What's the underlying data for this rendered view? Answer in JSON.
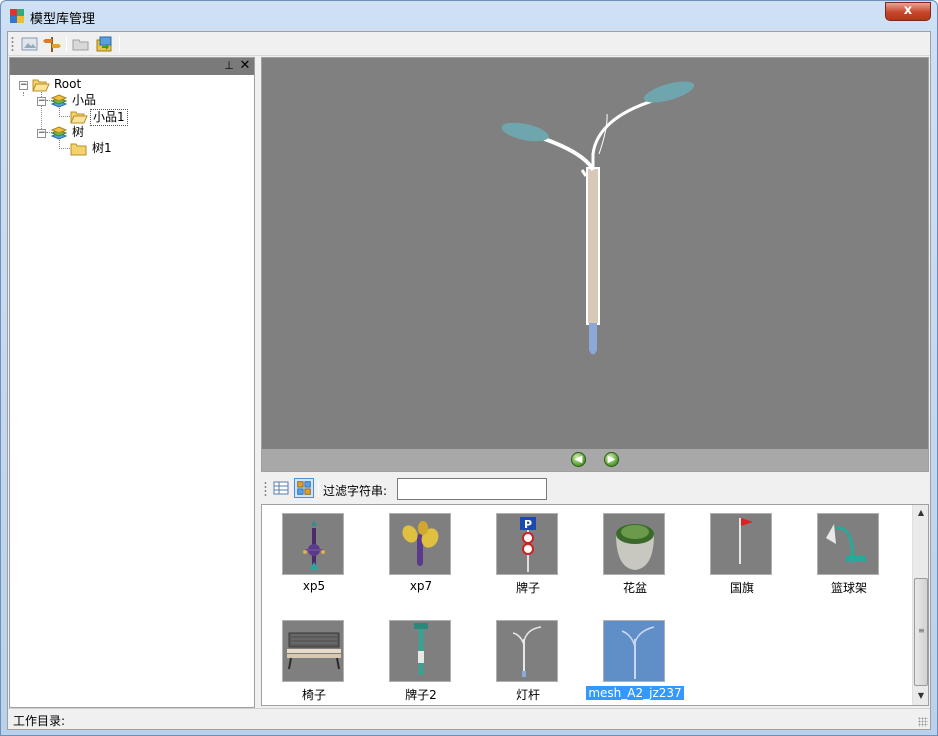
{
  "window": {
    "title": "模型库管理",
    "close_label": "x"
  },
  "toolbar": {
    "buttons": [
      {
        "icon": "image-icon"
      },
      {
        "icon": "signpost-icon"
      },
      {
        "icon": "folder-open-icon"
      },
      {
        "icon": "import-icon"
      }
    ]
  },
  "left_panel": {
    "pin_label": "📌",
    "close_label": "✕",
    "tree": [
      {
        "label": "Root",
        "expander": "−"
      },
      {
        "label": "小品",
        "expander": "−"
      },
      {
        "label": "小品1"
      },
      {
        "label": "树",
        "expander": "−"
      },
      {
        "label": "树1"
      }
    ]
  },
  "viewer": {
    "prev_label": "◀",
    "next_label": "▶"
  },
  "filter": {
    "label": "过滤字符串:",
    "value": ""
  },
  "gallery": {
    "items": [
      {
        "label": "xp5"
      },
      {
        "label": "xp7"
      },
      {
        "label": "牌子"
      },
      {
        "label": "花盆"
      },
      {
        "label": "国旗"
      },
      {
        "label": "篮球架"
      },
      {
        "label": "椅子"
      },
      {
        "label": "牌子2"
      },
      {
        "label": "灯杆"
      },
      {
        "label": "mesh_A2_jz237",
        "selected": true
      }
    ]
  },
  "status": {
    "label": "工作目录:"
  },
  "colors": {
    "viewport_bg": "#808080",
    "selection": "#3399ff",
    "titlebar": "#c4d9f0"
  }
}
